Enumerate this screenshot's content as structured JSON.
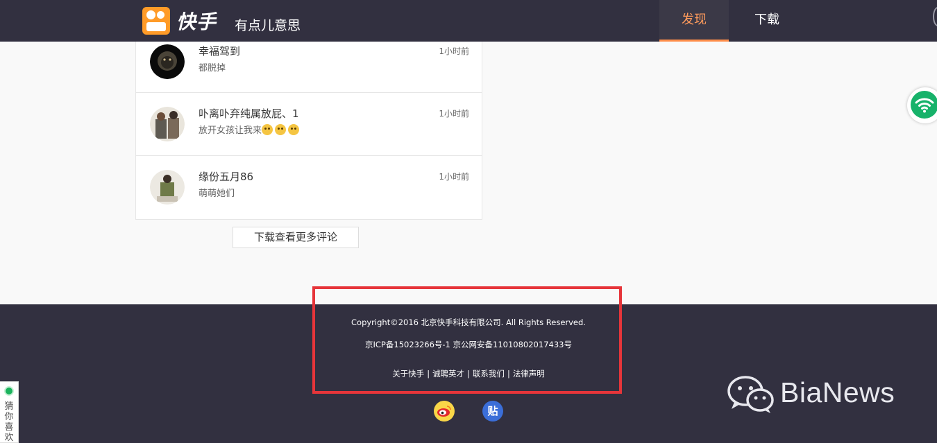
{
  "header": {
    "logo_text": "快手",
    "slogan": "有点儿意思",
    "nav": [
      {
        "label": "发现",
        "active": true
      },
      {
        "label": "下载",
        "active": false
      }
    ]
  },
  "comments": [
    {
      "name": "幸福驾到",
      "text": "都脱掉",
      "time": "1小时前"
    },
    {
      "name": "卟离卟弃纯属放屁、1",
      "text": "放开女孩让我来",
      "time": "1小时前"
    },
    {
      "name": "缘份五月86",
      "text": "萌萌她们",
      "time": "1小时前"
    }
  ],
  "more_comments_label": "下载查看更多评论",
  "footer": {
    "copyright": "Copyright©2016 北京快手科技有限公司. All Rights Reserved.",
    "icp": "京ICP备15023266号-1 京公网安备11010802017433号",
    "links": [
      "关于快手",
      "诚聘英才",
      "联系我们",
      "法律声明"
    ],
    "link_separator": "|",
    "tieba_label": "贴"
  },
  "watermark": "BiaNews",
  "side_widget": {
    "guess_label": "猜你喜欢"
  },
  "colors": {
    "header_bg": "#323040",
    "accent_orange": "#ff9b28",
    "highlight_box": "#e6353a",
    "wifi_green": "#17b26a"
  },
  "icons": [
    "kuaishou-logo-icon",
    "wifi-icon",
    "weibo-icon",
    "tieba-icon",
    "wechat-icon"
  ]
}
